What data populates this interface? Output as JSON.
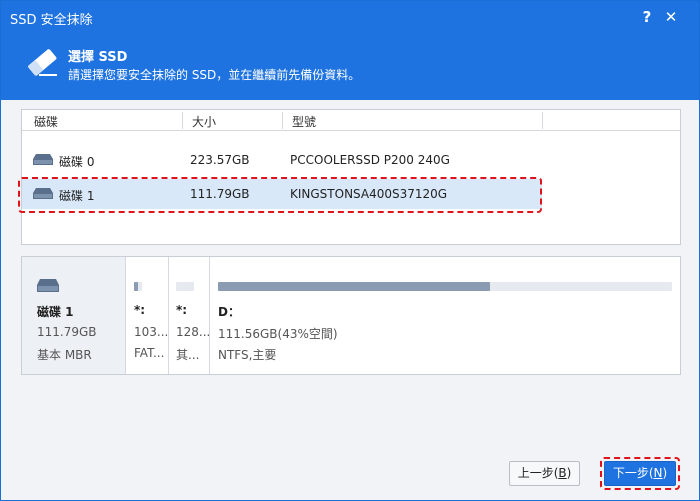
{
  "window": {
    "title": "SSD 安全抹除",
    "help_label": "?",
    "close_label": "✕"
  },
  "header": {
    "title": "選擇 SSD",
    "subtitle": "請選擇您要安全抹除的 SSD，並在繼續前先備份資料。"
  },
  "disk_list": {
    "columns": [
      "磁碟",
      "大小",
      "型號"
    ],
    "rows": [
      {
        "name": "磁碟 0",
        "size": "223.57GB",
        "model": "PCCOOLERSSD P200 240G",
        "selected": false
      },
      {
        "name": "磁碟 1",
        "size": "111.79GB",
        "model": "KINGSTONSA400S37120G",
        "selected": true
      }
    ]
  },
  "disk_map": {
    "disk_name": "磁碟 1",
    "disk_size": "111.79GB",
    "disk_type": "基本 MBR",
    "partitions": [
      {
        "letter": "*:",
        "size": "103...",
        "fs": "FAT...",
        "used_fraction": 0.5
      },
      {
        "letter": "*:",
        "size": "128...",
        "fs": "其...",
        "used_fraction": 0.0
      },
      {
        "letter": "D：",
        "size": "111.56GB(43%空間)",
        "fs": "NTFS,主要",
        "used_fraction": 0.6
      }
    ]
  },
  "buttons": {
    "prev_label": "上一步(",
    "prev_key": "B",
    "prev_end": ")",
    "next_label": "下一步(",
    "next_key": "N",
    "next_end": ")"
  },
  "colors": {
    "header_blue": "#1e73e0",
    "selection": "#d9e8f9",
    "highlight_red": "#e0121b"
  }
}
